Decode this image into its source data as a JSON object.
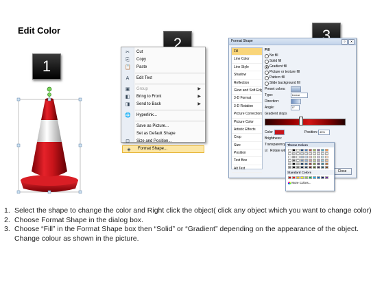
{
  "title": "Edit Color",
  "badges": [
    "1",
    "2",
    "3"
  ],
  "context_menu": {
    "items": [
      {
        "icon": "cut-icon",
        "glyph": "✂",
        "label": "Cut",
        "arrow": false,
        "disabled": false,
        "highlight": false
      },
      {
        "icon": "copy-icon",
        "glyph": "⎘",
        "label": "Copy",
        "arrow": false,
        "disabled": false,
        "highlight": false
      },
      {
        "icon": "paste-icon",
        "glyph": "📋",
        "label": "Paste",
        "arrow": false,
        "disabled": false,
        "highlight": false
      },
      {
        "sep": true
      },
      {
        "icon": "edit-text-icon",
        "glyph": "A",
        "label": "Edit Text",
        "arrow": false,
        "disabled": false,
        "highlight": false
      },
      {
        "sep": true
      },
      {
        "icon": "group-icon",
        "glyph": "▣",
        "label": "Group",
        "arrow": true,
        "disabled": true,
        "highlight": false
      },
      {
        "icon": "bring-to-front-icon",
        "glyph": "◧",
        "label": "Bring to Front",
        "arrow": true,
        "disabled": false,
        "highlight": false
      },
      {
        "icon": "send-to-back-icon",
        "glyph": "◨",
        "label": "Send to Back",
        "arrow": true,
        "disabled": false,
        "highlight": false
      },
      {
        "sep": true
      },
      {
        "icon": "hyperlink-icon",
        "glyph": "🌐",
        "label": "Hyperlink...",
        "arrow": false,
        "disabled": false,
        "highlight": false
      },
      {
        "sep": true
      },
      {
        "icon": "",
        "glyph": "",
        "label": "Save as Picture...",
        "arrow": false,
        "disabled": false,
        "highlight": false
      },
      {
        "icon": "",
        "glyph": "",
        "label": "Set as Default Shape",
        "arrow": false,
        "disabled": false,
        "highlight": false
      },
      {
        "icon": "size-position-icon",
        "glyph": "⊡",
        "label": "Size and Position...",
        "arrow": false,
        "disabled": false,
        "highlight": false
      },
      {
        "icon": "format-shape-icon",
        "glyph": "◈",
        "label": "Format Shape...",
        "arrow": false,
        "disabled": false,
        "highlight": true
      }
    ]
  },
  "dialog": {
    "title": "Format Shape",
    "nav": [
      "Fill",
      "Line Color",
      "Line Style",
      "Shadow",
      "Reflection",
      "Glow and Soft Edges",
      "3-D Format",
      "3-D Rotation",
      "Picture Corrections",
      "Picture Color",
      "Artistic Effects",
      "Crop",
      "Size",
      "Position",
      "Text Box",
      "Alt Text"
    ],
    "nav_selected": 0,
    "pane_title": "Fill",
    "options": [
      {
        "label": "No fill",
        "on": false
      },
      {
        "label": "Solid fill",
        "on": false
      },
      {
        "label": "Gradient fill",
        "on": true
      },
      {
        "label": "Picture or texture fill",
        "on": false
      },
      {
        "label": "Pattern fill",
        "on": false
      },
      {
        "label": "Slide background fill",
        "on": false
      }
    ],
    "preset_label": "Preset colors:",
    "type_label": "Type:",
    "type_value": "Linear",
    "direction_label": "Direction:",
    "angle_label": "Angle:",
    "angle_value": "0°",
    "stops_label": "Gradient stops",
    "color_label": "Color",
    "position_label": "Position:",
    "position_value": "45%",
    "brightness_label": "Brightness:",
    "transparency_label": "Transparency:",
    "rotate_label": "Rotate with shape",
    "close_label": "Close"
  },
  "picker": {
    "theme_title": "Theme Colors",
    "standard_title": "Standard Colors",
    "more_label": "More Colors..."
  },
  "instructions": [
    {
      "num": "1.",
      "text": "Select the shape to change the color and Right click the object( click any object which you want to change color)"
    },
    {
      "num": "2.",
      "text": "Choose Format Shape in the dialog box."
    },
    {
      "num": "3.",
      "text": "Choose “Fill” in the Format Shape box then “Solid” or “Gradient” depending on the appearance of the object. Change colour as shown in the picture."
    }
  ],
  "colors": {
    "cone_red": "#c8141a",
    "cone_white": "#f4f4f4",
    "menu_highlight": "#fce6a4",
    "dialog_select": "#f9d57a",
    "gradient_dark": "#2a0000",
    "gradient_red": "#d21414"
  }
}
